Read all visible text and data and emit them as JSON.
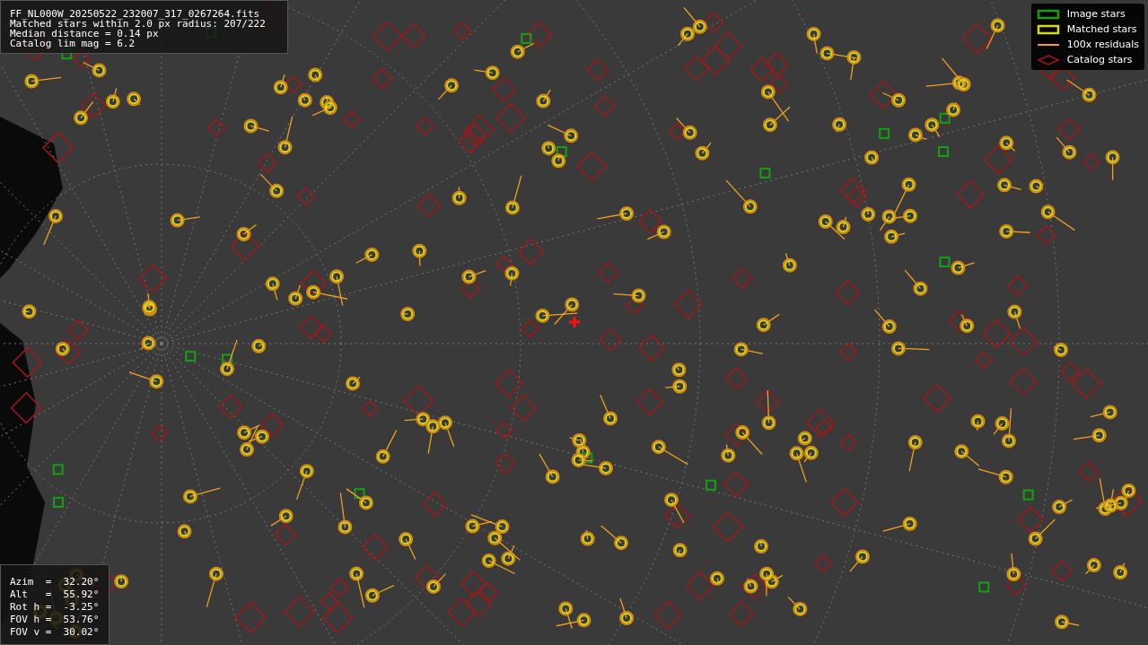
{
  "header": {
    "lines": [
      "FF_NL000W_20250522_232007_317_0267264.fits",
      "Matched stars within 2.0 px radius: 207/222",
      "Median distance = 0.14 px",
      "Catalog lim mag = 6.2"
    ]
  },
  "legend": [
    {
      "kind": "image",
      "label": "Image stars"
    },
    {
      "kind": "matched",
      "label": "Matched stars"
    },
    {
      "kind": "residual",
      "label": "100x residuals"
    },
    {
      "kind": "catalog",
      "label": "Catalog stars"
    }
  ],
  "pointing": {
    "lines": [
      "Azim  =  32.20°",
      "Alt   =  55.92°",
      "Rot h =  -3.25°",
      "FOV h =  53.76°",
      "FOV v =  30.02°"
    ]
  }
}
